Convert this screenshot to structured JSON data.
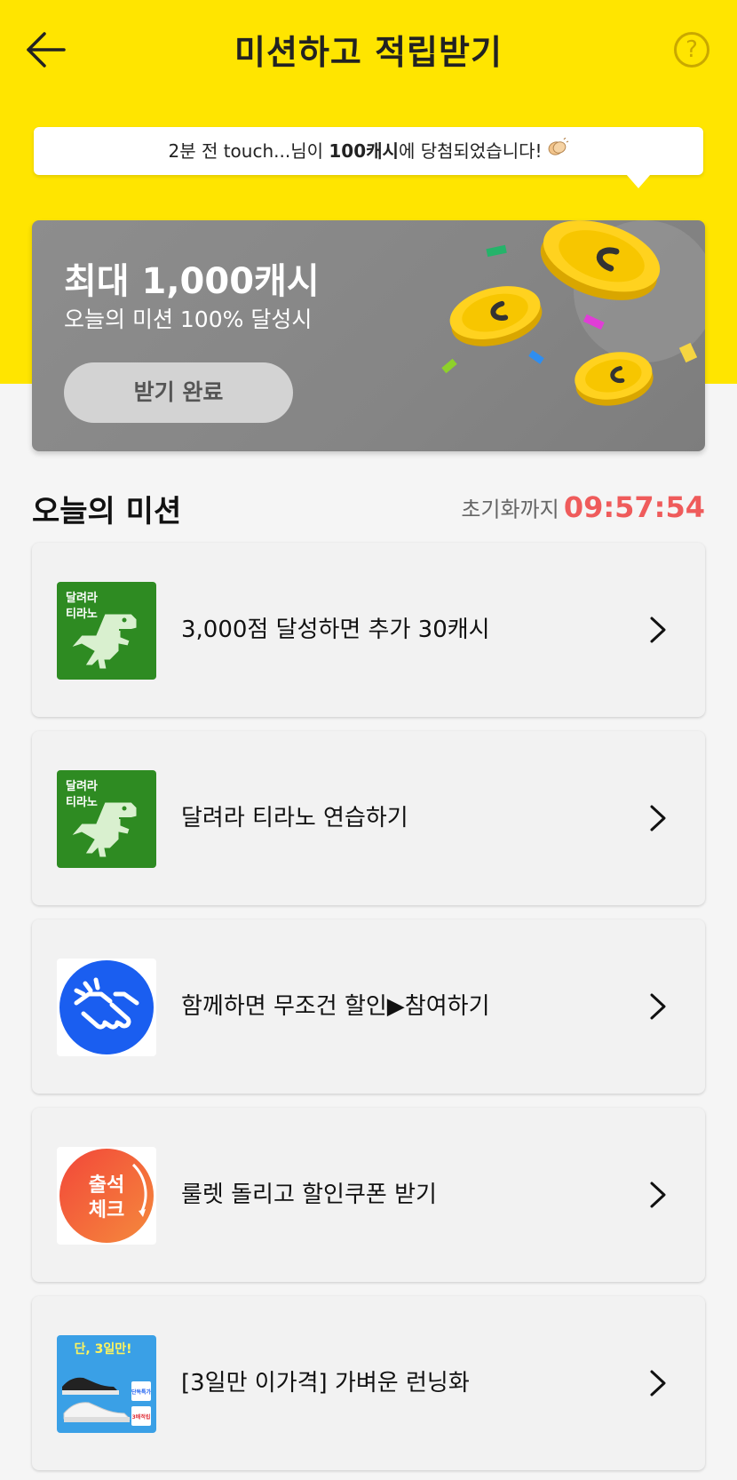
{
  "header": {
    "title": "미션하고 적립받기",
    "help_label": "?"
  },
  "ticker": {
    "prefix": "2분 전 touch...님이 ",
    "highlight": "100캐시",
    "suffix": "에 당첨되었습니다!"
  },
  "reward": {
    "title": "최대 1,000캐시",
    "subtitle": "오늘의 미션 100% 달성시",
    "button_label": "받기 완료"
  },
  "section": {
    "title": "오늘의 미션",
    "reset_label": "초기화까지",
    "reset_time": "09:57:54"
  },
  "missions": [
    {
      "label": "3,000점 달성하면 추가 30캐시",
      "thumb_text_1": "달려라",
      "thumb_text_2": "티라노"
    },
    {
      "label": "달려라 티라노 연습하기",
      "thumb_text_1": "달려라",
      "thumb_text_2": "티라노"
    },
    {
      "label": "함께하면 무조건 할인▶참여하기"
    },
    {
      "label": "룰렛 돌리고 할인쿠폰 받기",
      "thumb_text_1": "출석",
      "thumb_text_2": "체크"
    },
    {
      "label": "[3일만 이가격] 가벼운 런닝화",
      "thumb_text_1": "단, 3일만!",
      "thumb_badge_1": "단독특가",
      "thumb_badge_2": "3배적립"
    }
  ],
  "colors": {
    "brand_yellow": "#ffe500",
    "timer_red": "#ef5b5b",
    "dino_green": "#2e8b22",
    "handshake_blue": "#1a5ef0",
    "check_orange": "#f0553a"
  }
}
